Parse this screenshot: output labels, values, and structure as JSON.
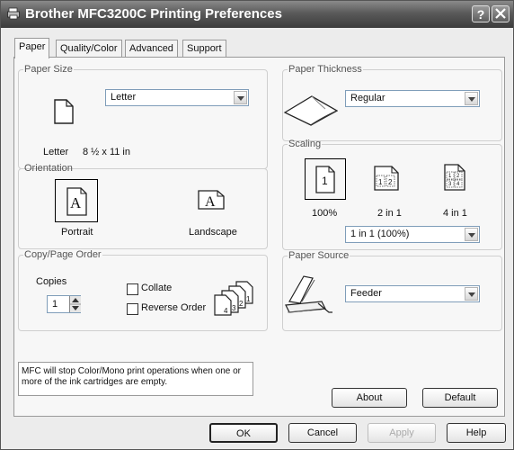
{
  "window": {
    "title": "Brother MFC3200C Printing Preferences",
    "help_label": "?"
  },
  "tabs": [
    {
      "label": "Paper"
    },
    {
      "label": "Quality/Color"
    },
    {
      "label": "Advanced"
    },
    {
      "label": "Support"
    }
  ],
  "paper_size": {
    "legend": "Paper Size",
    "selected": "Letter",
    "name": "Letter",
    "dimensions": "8 ½ x 11 in"
  },
  "orientation": {
    "legend": "Orientation",
    "options": [
      {
        "label": "Portrait",
        "selected": true
      },
      {
        "label": "Landscape",
        "selected": false
      }
    ]
  },
  "copy_order": {
    "legend": "Copy/Page Order",
    "copies_label": "Copies",
    "copies_value": "1",
    "collate_label": "Collate",
    "reverse_label": "Reverse Order",
    "stack_numbers": [
      "4",
      "3",
      "2",
      "1"
    ]
  },
  "paper_thickness": {
    "legend": "Paper Thickness",
    "selected": "Regular"
  },
  "scaling": {
    "legend": "Scaling",
    "options": [
      {
        "label": "100%",
        "selected": true
      },
      {
        "label": "2 in 1"
      },
      {
        "label": "4 in 1"
      }
    ],
    "selected": "1 in 1 (100%)",
    "single_glyph": "1",
    "two_up": [
      "1",
      "2"
    ],
    "four_up": [
      "1",
      "2",
      "3",
      "4"
    ]
  },
  "paper_source": {
    "legend": "Paper Source",
    "selected": "Feeder"
  },
  "info_text": "MFC will stop Color/Mono print operations when one or more of the ink cartridges are empty.",
  "buttons": {
    "about": "About",
    "default": "Default",
    "ok": "OK",
    "cancel": "Cancel",
    "apply": "Apply",
    "help": "Help"
  }
}
